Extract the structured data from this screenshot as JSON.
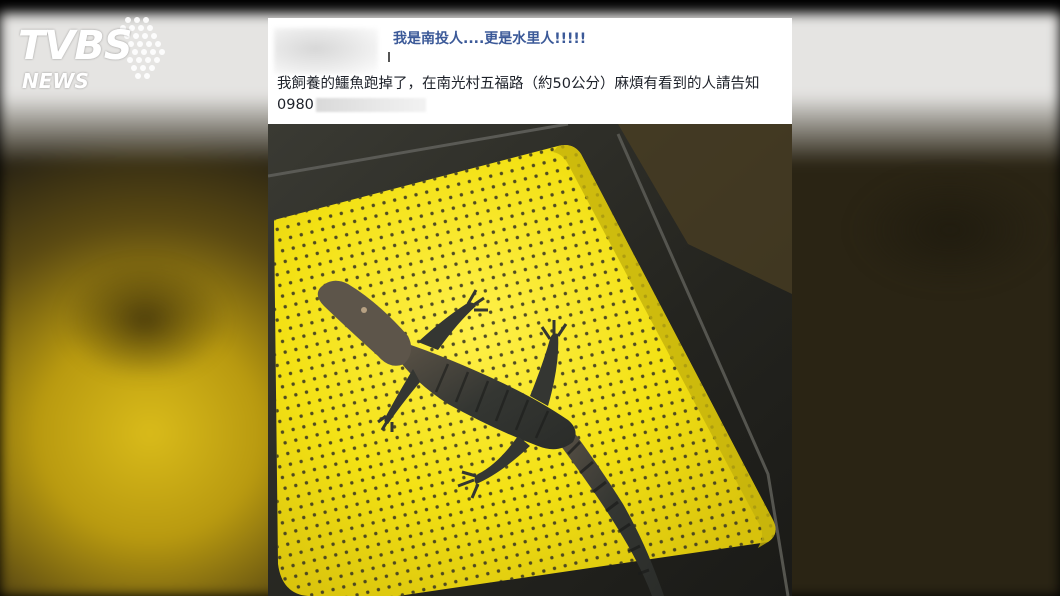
{
  "logo": {
    "main": "TVBS",
    "sub": "NEWS"
  },
  "post": {
    "author": "我是南投人....更是水里人!!!!!",
    "text": "我飼養的鱷魚跑掉了，在南光村五福路（約50公分）麻煩有看到的人請告知0980"
  },
  "photo": {
    "subject": "crocodile-on-yellow-tray",
    "colors": {
      "tray": "#f5e414",
      "tray_shadow": "#d6c40f",
      "water": "#2c2c27",
      "crocodile": "#2f3430"
    }
  }
}
